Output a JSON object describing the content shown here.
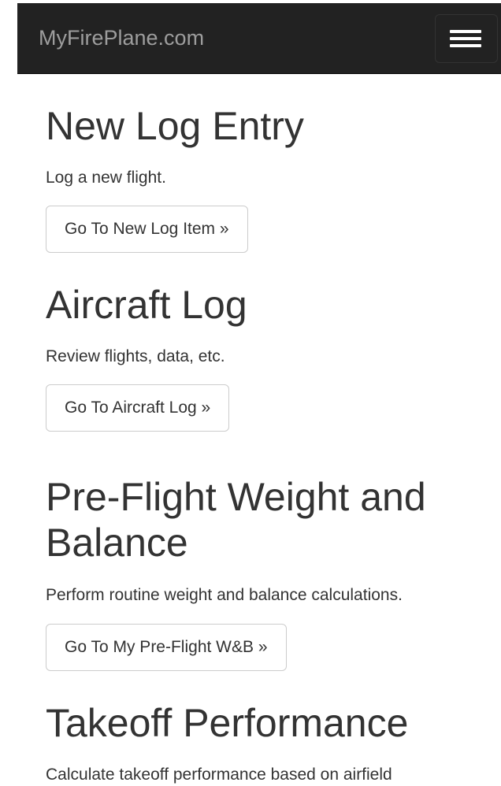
{
  "navbar": {
    "brand": "MyFirePlane.com",
    "toggle_icon": "hamburger-menu-icon"
  },
  "sections": [
    {
      "title": "New Log Entry",
      "description": "Log a new flight.",
      "button_label": "Go To New Log Item »"
    },
    {
      "title": "Aircraft Log",
      "description": "Review flights, data, etc.",
      "button_label": "Go To Aircraft Log »"
    },
    {
      "title": "Pre-Flight Weight and Balance",
      "description": "Perform routine weight and balance calculations.",
      "button_label": "Go To My Pre-Flight W&B »"
    },
    {
      "title": "Takeoff Performance",
      "description": "Calculate takeoff performance based on airfield"
    }
  ],
  "colors": {
    "navbar_bg": "#222222",
    "brand_text": "#9d9d9d",
    "body_text": "#333333",
    "button_border": "#cccccc"
  }
}
